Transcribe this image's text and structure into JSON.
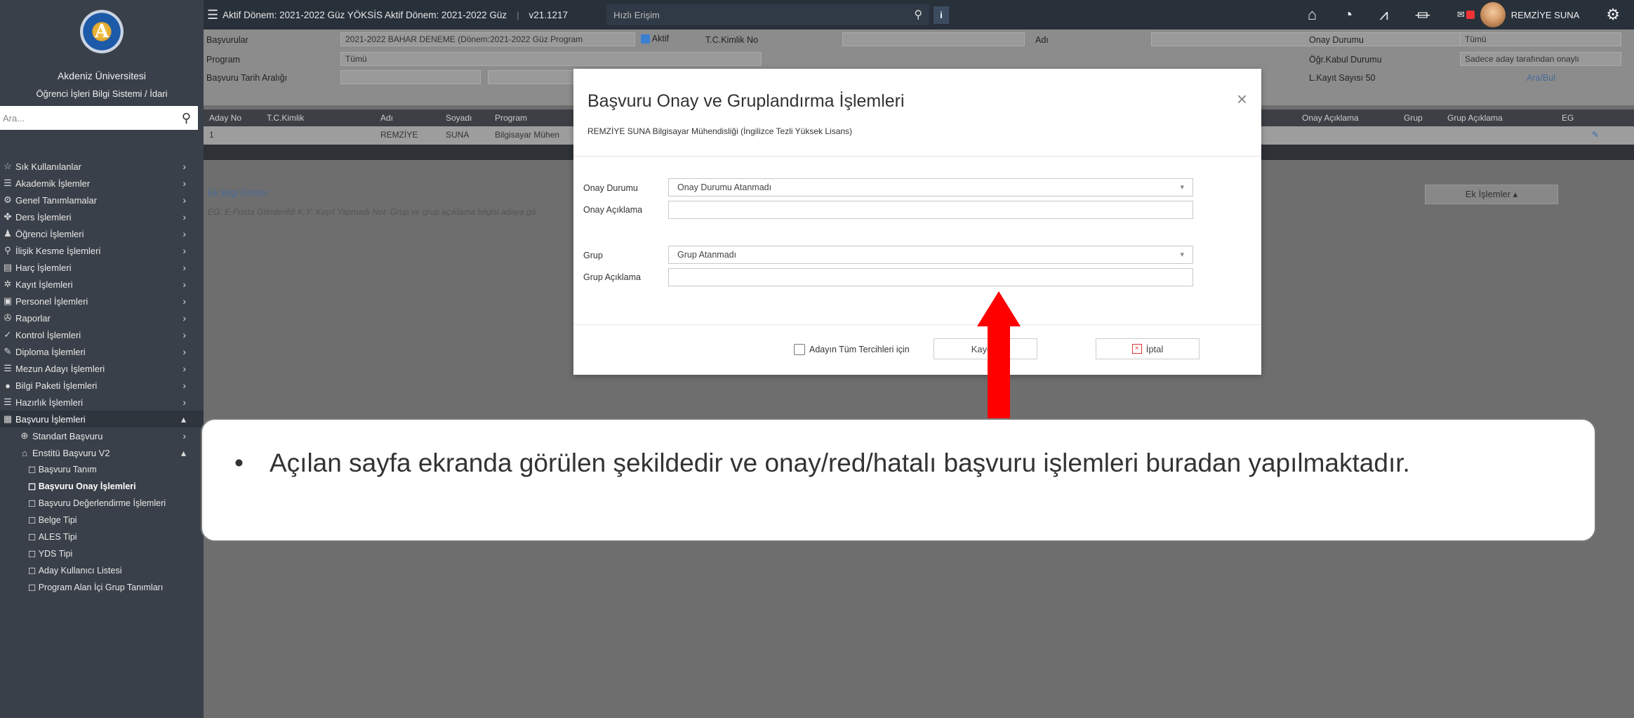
{
  "sidebar": {
    "uni_name": "Akdeniz Üniversitesi",
    "uni_sub": "Öğrenci İşleri Bilgi Sistemi / İdari",
    "search_placeholder": "Ara...",
    "items": [
      {
        "label": "Sık Kullanılanlar"
      },
      {
        "label": "Akademik İşlemler"
      },
      {
        "label": "Genel Tanımlamalar"
      },
      {
        "label": "Ders İşlemleri"
      },
      {
        "label": "Öğrenci İşlemleri"
      },
      {
        "label": "İlişik Kesme İşlemleri"
      },
      {
        "label": "Harç İşlemleri"
      },
      {
        "label": "Kayıt İşlemleri"
      },
      {
        "label": "Personel İşlemleri"
      },
      {
        "label": "Raporlar"
      },
      {
        "label": "Kontrol İşlemleri"
      },
      {
        "label": "Diploma İşlemleri"
      },
      {
        "label": "Mezun Adayı İşlemleri"
      },
      {
        "label": "Bilgi Paketi İşlemleri"
      },
      {
        "label": "Hazırlık İşlemleri"
      },
      {
        "label": "Başvuru İşlemleri"
      }
    ],
    "sub_items": [
      {
        "label": "Standart Başvuru"
      },
      {
        "label": "Enstitü Başvuru V2"
      }
    ],
    "subsub_items": [
      {
        "label": "Başvuru Tanım"
      },
      {
        "label": "Başvuru Onay İşlemleri"
      },
      {
        "label": "Başvuru Değerlendirme İşlemleri"
      },
      {
        "label": "Belge Tipi"
      },
      {
        "label": "ALES Tipi"
      },
      {
        "label": "YDS Tipi"
      },
      {
        "label": "Aday Kullanıcı Listesi"
      },
      {
        "label": "Program Alan İçi Grup Tanımları"
      }
    ]
  },
  "topbar": {
    "term": "Aktif Dönem: 2021-2022 Güz YÖKSİS Aktif Dönem: 2021-2022 Güz",
    "version": "v21.1217",
    "quick_placeholder": "Hızlı Erişim",
    "user_name": "REMZİYE SUNA"
  },
  "filter": {
    "basvurular_label": "Başvurular",
    "basvurular_value": "2021-2022 BAHAR DENEME (Dönem:2021-2022 Güz Program",
    "aktif_label": "Aktif",
    "tc_label": "T.C.Kimlik No",
    "adi_label": "Adı",
    "onay_durumu_label": "Onay Durumu",
    "onay_durumu_value": "Tümü",
    "program_label": "Program",
    "program_value": "Tümü",
    "ogr_kabul_label": "Öğr.Kabul Durumu",
    "ogr_kabul_value": "Sadece aday tarafından onaylı",
    "tarih_label": "Başvuru Tarih Aralığı",
    "kayit_sayisi": "L.Kayıt Sayısı 50",
    "ara_bul": "Ara/Bul"
  },
  "grid": {
    "headers": [
      "Aday No",
      "T.C.Kimlik",
      "Adı",
      "Soyadı",
      "Program",
      "Onay Açıklama",
      "Grup",
      "Grup Açıklama",
      "EG"
    ],
    "row": {
      "aday_no": "1",
      "adi": "REMZİYE",
      "soyadi": "SUNA",
      "program": "Bilgisayar Mühen"
    }
  },
  "main": {
    "ek_bilgi": "Ek Bilgi Göster",
    "note": "EG: E-Posta Gönderildi   K.Y: Kayıt Yapmadı   Not: Grup ve grup açıklama bilgisi adaya gö",
    "ek_islemler": "Ek İşlemler ▴"
  },
  "modal": {
    "title": "Başvuru Onay ve Gruplandırma İşlemleri",
    "subtitle": "REMZİYE SUNA Bilgisayar Mühendisliği (İngilizce Tezli Yüksek Lisans)",
    "onay_durumu_label": "Onay Durumu",
    "onay_durumu_value": "Onay Durumu Atanmadı",
    "onay_aciklama_label": "Onay Açıklama",
    "grup_label": "Grup",
    "grup_value": "Grup Atanmadı",
    "grup_aciklama_label": "Grup Açıklama",
    "checkbox_label": "Adayın Tüm Tercihleri için",
    "kaydet": "Kaydet",
    "iptal": "İptal"
  },
  "callout": {
    "bullet": "•",
    "text": "Açılan sayfa ekranda görülen şekildedir ve onay/red/hatalı başvuru işlemleri buradan yapılmaktadır."
  },
  "colors": {
    "arrow": "#ff0000",
    "sidebar": "#3a4049",
    "topbar": "#28303a"
  }
}
